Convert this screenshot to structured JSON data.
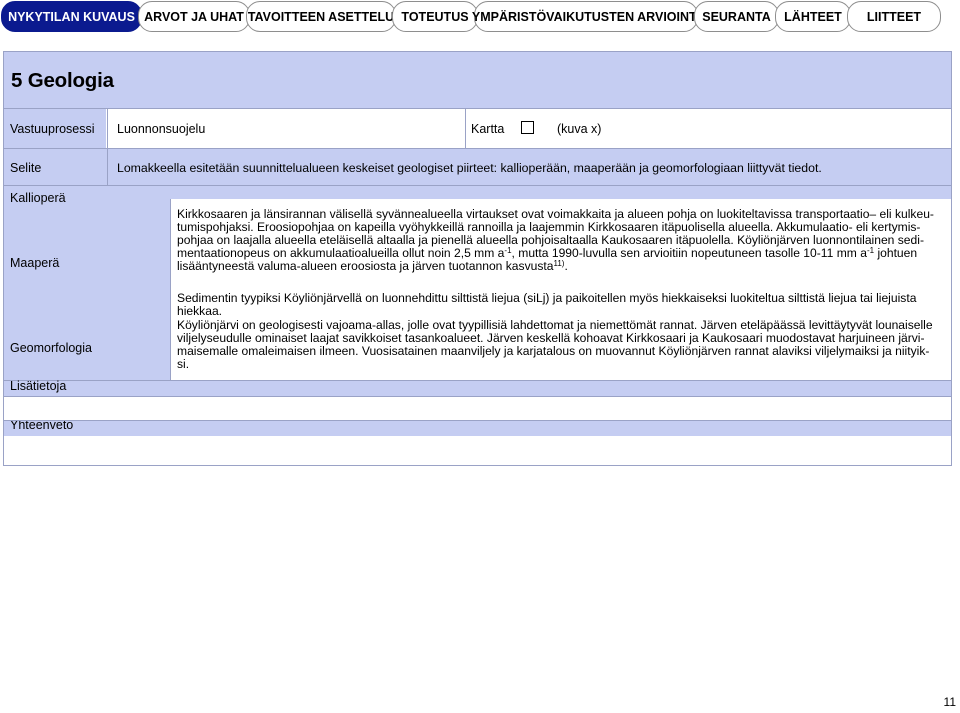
{
  "nav": {
    "tabs": [
      {
        "label": "NYKYTILAN KUVAUS",
        "active": true
      },
      {
        "label": "ARVOT JA UHAT",
        "active": false
      },
      {
        "label": "TAVOITTEEN ASETTELU",
        "active": false
      },
      {
        "label": "TOTEUTUS",
        "active": false
      },
      {
        "label": "YMPÄRISTÖVAIKUTUSTEN ARVIOINTI",
        "active": false
      },
      {
        "label": "SEURANTA",
        "active": false
      },
      {
        "label": "LÄHTEET",
        "active": false
      },
      {
        "label": "LIITTEET",
        "active": false
      }
    ],
    "colors": {
      "active_bg": "#0b1a8f",
      "active_text": "#ffffff",
      "inactive_bg": "#ffffff"
    }
  },
  "form": {
    "title": "5 Geologia",
    "vastuuprosessi_label": "Vastuuprosessi",
    "vastuuprosessi_value": "Luonnonsuojelu",
    "kartta_label": "Kartta",
    "kartta_checked": false,
    "kuva_label": "(kuva x)",
    "selite_label": "Selite",
    "selite_value": "Lomakkeella esitetään suunnittelualueen keskeiset geologiset piirteet: kallioperään, maaperään ja geomorfologiaan liittyvät tiedot.",
    "kalliopera_label": "Kallioperä",
    "maapera_label": "Maaperä",
    "geomorfologia_label": "Geomorfologia",
    "lisatietoja_label": "Lisätietoja",
    "yhteenveto_label": "Yhteenveto",
    "maapera_lines": [
      "Kirkkosaaren ja länsirannan välisellä syvännealueella virtaukset ovat voimakkaita ja alueen pohja on luokiteltavissa transportaatio– eli kulkeu-",
      "tumispohjaksi. Eroosiopohjaa on kapeilla vyöhykkeillä rannoilla ja laajemmin Kirkkosaaren itäpuolisella alueella. Akkumulaatio- eli kertymis-",
      "pohjaa on laajalla alueella eteläisellä altaalla ja pienellä alueella pohjoisaltaalla Kaukosaaren itäpuolella. Köyliönjärven luonnontilainen sedi-"
    ],
    "maapera_line4_a": "mentaationopeus on akkumulaatioalueilla ollut noin 2,5 mm a",
    "maapera_line4_sup1": "-1",
    "maapera_line4_b": ", mutta 1990-luvulla sen arvioitiin nopeutuneen tasolle 10-11 mm a",
    "maapera_line4_sup2": "-1",
    "maapera_line4_c": " johtuen",
    "maapera_line5_a": "lisääntyneestä valuma-alueen eroosiosta ja järven tuotannon kasvusta",
    "maapera_line5_sup": "11)",
    "maapera_line5_b": ".",
    "sediment_lines": [
      "Sedimentin tyypiksi Köyliönjärvellä on luonnehdittu silttistä liejua (siLj) ja paikoitellen myös hiekkaiseksi luokiteltua silttistä liejua tai liejuista",
      "hiekkaa."
    ],
    "geomorf_lines": [
      "Köyliönjärvi on geologisesti vajoama-allas, jolle ovat tyypillisiä lahdettomat ja niemettömät rannat. Järven eteläpäässä levittäytyvät lounaiselle",
      "viljelyseudulle ominaiset laajat savikkoiset tasankoalueet. Järven keskellä kohoavat Kirkkosaari ja Kaukosaari muodostavat harjuineen järvi-",
      "maisemalle omaleimaisen ilmeen. Vuosisatainen maanviljely ja karjatalous on muovannut Köyliönjärven rannat alaviksi viljelymaiksi ja niityik-",
      "si."
    ]
  },
  "page_number": "11"
}
